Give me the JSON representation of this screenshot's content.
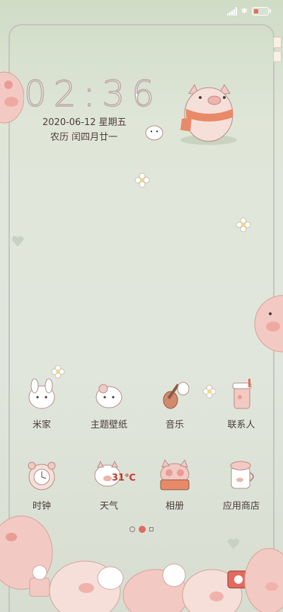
{
  "status_bar": {
    "signal_icon": "signal-icon",
    "bluetooth_icon": "bluetooth-icon",
    "battery_icon": "battery-icon"
  },
  "clock": {
    "time": "02:36"
  },
  "date_line": "2020-06-12   星期五",
  "lunar_line": "农历   闰四月廿一",
  "apps_row1": [
    {
      "label": "米家",
      "icon": "mijia-icon"
    },
    {
      "label": "主题壁纸",
      "icon": "theme-wallpaper-icon"
    },
    {
      "label": "音乐",
      "icon": "music-icon"
    },
    {
      "label": "联系人",
      "icon": "contacts-icon"
    }
  ],
  "apps_row2": [
    {
      "label": "时钟",
      "icon": "clock-icon"
    },
    {
      "label": "天气",
      "icon": "weather-icon",
      "badge": "31℃"
    },
    {
      "label": "相册",
      "icon": "gallery-icon"
    },
    {
      "label": "应用商店",
      "icon": "app-store-icon"
    }
  ],
  "colors": {
    "pig_pink": "#f3c9c3",
    "accent": "#e46a5e",
    "text": "#4a3a39"
  }
}
